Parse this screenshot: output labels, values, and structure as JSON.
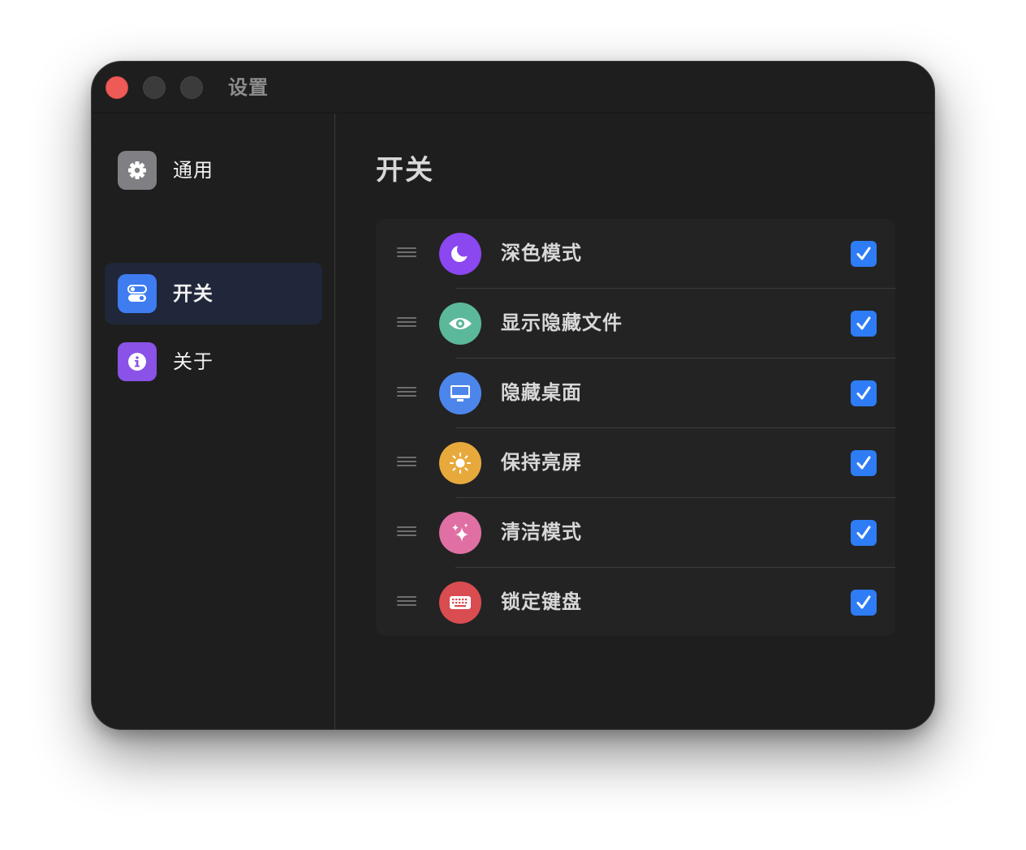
{
  "window": {
    "title": "设置"
  },
  "sidebar": {
    "items": [
      {
        "label": "通用",
        "icon": "gear-icon",
        "color": "#808084",
        "selected": false
      },
      {
        "label": "开关",
        "icon": "toggles-icon",
        "color": "#3e7cf0",
        "selected": true
      },
      {
        "label": "关于",
        "icon": "info-icon",
        "color": "#8a52e6",
        "selected": false
      }
    ]
  },
  "main": {
    "title": "开关",
    "toggles": [
      {
        "label": "深色模式",
        "icon": "moon-icon",
        "color": "#8b47f0",
        "checked": true
      },
      {
        "label": "显示隐藏文件",
        "icon": "eye-icon",
        "color": "#5cb89a",
        "checked": true
      },
      {
        "label": "隐藏桌面",
        "icon": "desktop-icon",
        "color": "#4d86ea",
        "checked": true
      },
      {
        "label": "保持亮屏",
        "icon": "sun-icon",
        "color": "#e8a93c",
        "checked": true
      },
      {
        "label": "清洁模式",
        "icon": "sparkles-icon",
        "color": "#e070a4",
        "checked": true
      },
      {
        "label": "锁定键盘",
        "icon": "keyboard-icon",
        "color": "#d94c50",
        "checked": true
      }
    ]
  },
  "colors": {
    "accent": "#2e7cf6",
    "background": "#1e1e1e",
    "list_background": "#232323",
    "selected_sidebar": "#20273a"
  }
}
